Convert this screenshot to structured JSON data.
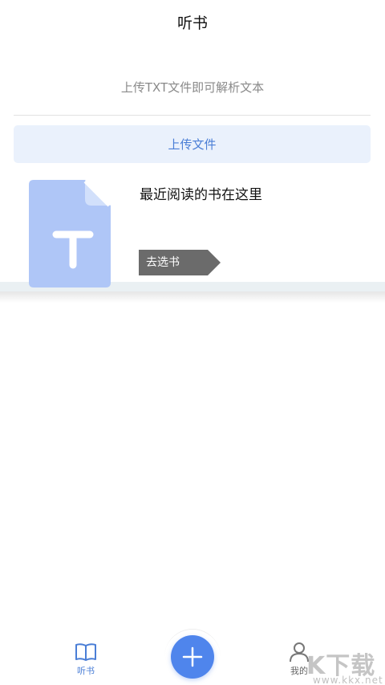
{
  "header": {
    "title": "听书"
  },
  "upload": {
    "hint": "上传TXT文件即可解析文本",
    "button_label": "上传文件"
  },
  "recent": {
    "title": "最近阅读的书在这里",
    "choose_label": "去选书",
    "file_icon_letter": "T"
  },
  "tabbar": {
    "listen_label": "听书",
    "mine_label": "我的",
    "add_icon": "plus-icon",
    "listen_icon": "book-icon",
    "mine_icon": "user-icon"
  },
  "watermark": {
    "logo": "K下载",
    "url": "www.kkx.net"
  },
  "colors": {
    "accent": "#4f85ec",
    "button_bg": "#eaf1fc",
    "file_icon": "#afc6f7",
    "tag_bg": "#6b6b6b"
  }
}
